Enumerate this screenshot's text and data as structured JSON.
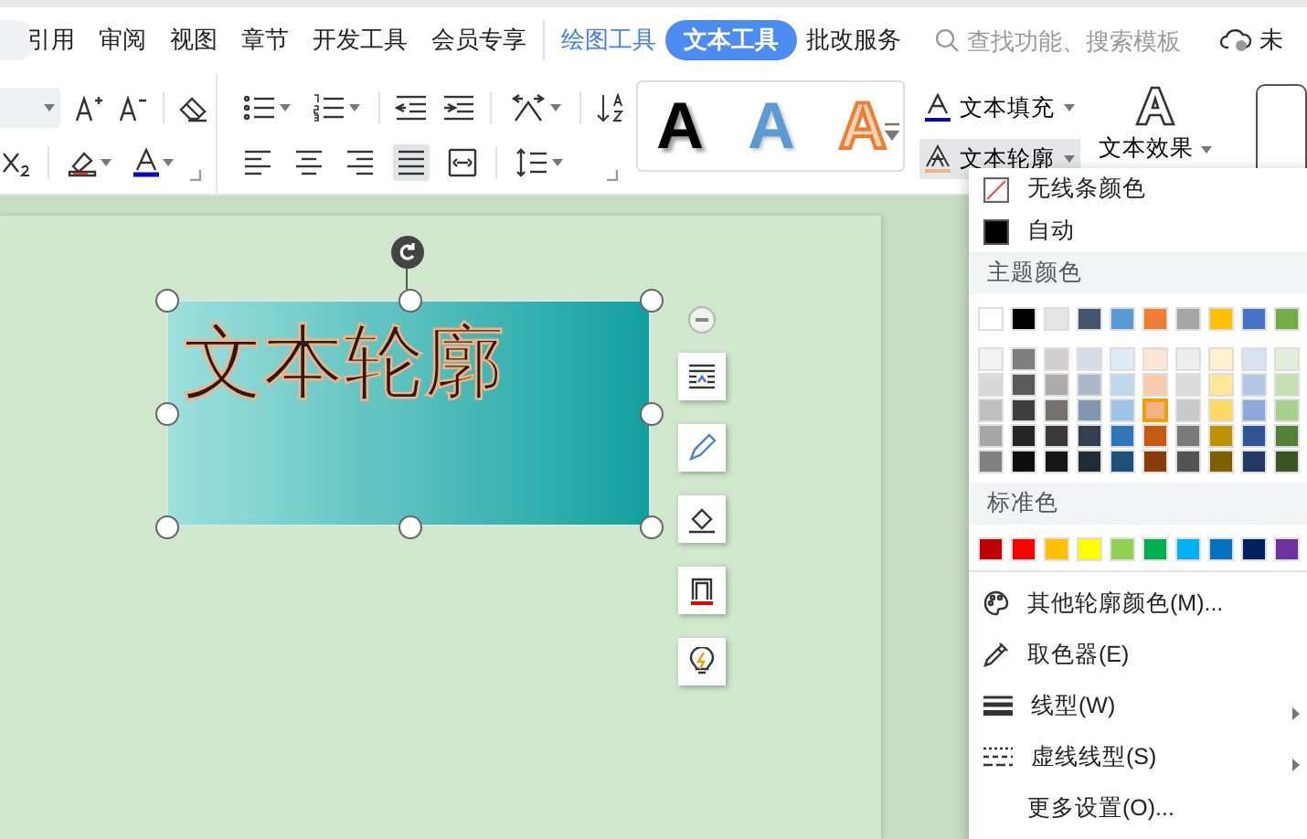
{
  "tabs": [
    {
      "label": "引用",
      "selected": false,
      "kind": "normal"
    },
    {
      "label": "审阅",
      "selected": false,
      "kind": "normal"
    },
    {
      "label": "视图",
      "selected": false,
      "kind": "normal"
    },
    {
      "label": "章节",
      "selected": false,
      "kind": "normal"
    },
    {
      "label": "开发工具",
      "selected": false,
      "kind": "normal"
    },
    {
      "label": "会员专享",
      "selected": false,
      "kind": "normal"
    },
    {
      "label": "绘图工具",
      "selected": false,
      "kind": "context"
    },
    {
      "label": "文本工具",
      "selected": true,
      "kind": "context"
    },
    {
      "label": "批改服务",
      "selected": false,
      "kind": "normal"
    }
  ],
  "search": {
    "placeholder": "查找功能、搜索模板"
  },
  "account": {
    "label": "未"
  },
  "alignment": [
    {
      "kind": "left",
      "selected": false
    },
    {
      "kind": "center",
      "selected": false
    },
    {
      "kind": "right",
      "selected": false
    },
    {
      "kind": "justify",
      "selected": true
    },
    {
      "kind": "distribute",
      "selected": false
    }
  ],
  "style_gallery": [
    {
      "text": "A",
      "kind": "black"
    },
    {
      "text": "A",
      "kind": "blue"
    },
    {
      "text": "A",
      "kind": "orange"
    }
  ],
  "text_fill": {
    "label": "文本填充"
  },
  "text_outline": {
    "label": "文本轮廓",
    "expanded": true
  },
  "text_effect": {
    "label": "文本效果"
  },
  "textbox": {
    "text": "文本轮廓"
  },
  "outline_menu": {
    "no_line": "无线条颜色",
    "automatic": "自动",
    "theme_header": "主题颜色",
    "theme_colors": [
      {
        "color": "#ffffff",
        "selected": false
      },
      {
        "color": "#000000",
        "selected": false
      },
      {
        "color": "#e7e6e6",
        "selected": false
      },
      {
        "color": "#44546a",
        "selected": false
      },
      {
        "color": "#5b9bd5",
        "selected": false
      },
      {
        "color": "#ed7d31",
        "selected": false
      },
      {
        "color": "#a5a5a5",
        "selected": false
      },
      {
        "color": "#ffc000",
        "selected": false
      },
      {
        "color": "#4472c4",
        "selected": false
      },
      {
        "color": "#70ad47",
        "selected": false
      }
    ],
    "theme_tints": [
      [
        {
          "color": "#f2f2f2",
          "selected": false
        },
        {
          "color": "#7f7f7f",
          "selected": false
        },
        {
          "color": "#d0cece",
          "selected": false
        },
        {
          "color": "#d6dce4",
          "selected": false
        },
        {
          "color": "#deebf6",
          "selected": false
        },
        {
          "color": "#fbe5d5",
          "selected": false
        },
        {
          "color": "#ededed",
          "selected": false
        },
        {
          "color": "#fff2cc",
          "selected": false
        },
        {
          "color": "#d9e2f3",
          "selected": false
        },
        {
          "color": "#e2efd9",
          "selected": false
        }
      ],
      [
        {
          "color": "#d9d9d9",
          "selected": false
        },
        {
          "color": "#595959",
          "selected": false
        },
        {
          "color": "#aeabab",
          "selected": false
        },
        {
          "color": "#adb9ca",
          "selected": false
        },
        {
          "color": "#bdd7ee",
          "selected": false
        },
        {
          "color": "#f8cbad",
          "selected": false
        },
        {
          "color": "#dbdbdb",
          "selected": false
        },
        {
          "color": "#ffe699",
          "selected": false
        },
        {
          "color": "#b4c6e7",
          "selected": false
        },
        {
          "color": "#c5e0b3",
          "selected": false
        }
      ],
      [
        {
          "color": "#bfbfbf",
          "selected": false
        },
        {
          "color": "#404040",
          "selected": false
        },
        {
          "color": "#757171",
          "selected": false
        },
        {
          "color": "#8497b0",
          "selected": false
        },
        {
          "color": "#9dc3e6",
          "selected": false
        },
        {
          "color": "#f4b183",
          "selected": true
        },
        {
          "color": "#c9c9c9",
          "selected": false
        },
        {
          "color": "#ffd966",
          "selected": false
        },
        {
          "color": "#8eaadb",
          "selected": false
        },
        {
          "color": "#a8d08d",
          "selected": false
        }
      ],
      [
        {
          "color": "#a6a6a6",
          "selected": false
        },
        {
          "color": "#262626",
          "selected": false
        },
        {
          "color": "#3a3838",
          "selected": false
        },
        {
          "color": "#333f4f",
          "selected": false
        },
        {
          "color": "#2e75b5",
          "selected": false
        },
        {
          "color": "#c55a11",
          "selected": false
        },
        {
          "color": "#7b7b7b",
          "selected": false
        },
        {
          "color": "#bf9000",
          "selected": false
        },
        {
          "color": "#2f5496",
          "selected": false
        },
        {
          "color": "#538135",
          "selected": false
        }
      ],
      [
        {
          "color": "#808080",
          "selected": false
        },
        {
          "color": "#0d0d0d",
          "selected": false
        },
        {
          "color": "#171616",
          "selected": false
        },
        {
          "color": "#222a35",
          "selected": false
        },
        {
          "color": "#1f4e79",
          "selected": false
        },
        {
          "color": "#843c0b",
          "selected": false
        },
        {
          "color": "#525252",
          "selected": false
        },
        {
          "color": "#7f6000",
          "selected": false
        },
        {
          "color": "#1f3864",
          "selected": false
        },
        {
          "color": "#375623",
          "selected": false
        }
      ]
    ],
    "standard_header": "标准色",
    "standard_colors": [
      {
        "color": "#c00000",
        "selected": false
      },
      {
        "color": "#ff0000",
        "selected": false
      },
      {
        "color": "#ffc000",
        "selected": false
      },
      {
        "color": "#ffff00",
        "selected": false
      },
      {
        "color": "#92d050",
        "selected": false
      },
      {
        "color": "#00b050",
        "selected": false
      },
      {
        "color": "#00b0f0",
        "selected": false
      },
      {
        "color": "#0070c0",
        "selected": false
      },
      {
        "color": "#002060",
        "selected": false
      },
      {
        "color": "#7030a0",
        "selected": false
      }
    ],
    "items": [
      {
        "label": "其他轮廓颜色(M)...",
        "kind": "palette",
        "submenu": false
      },
      {
        "label": "取色器(E)",
        "kind": "eyedropper",
        "submenu": false
      },
      {
        "label": "线型(W)",
        "kind": "weight",
        "submenu": true
      },
      {
        "label": "虚线线型(S)",
        "kind": "dash",
        "submenu": true
      },
      {
        "label": "更多设置(O)...",
        "kind": "settings",
        "submenu": false
      }
    ]
  }
}
